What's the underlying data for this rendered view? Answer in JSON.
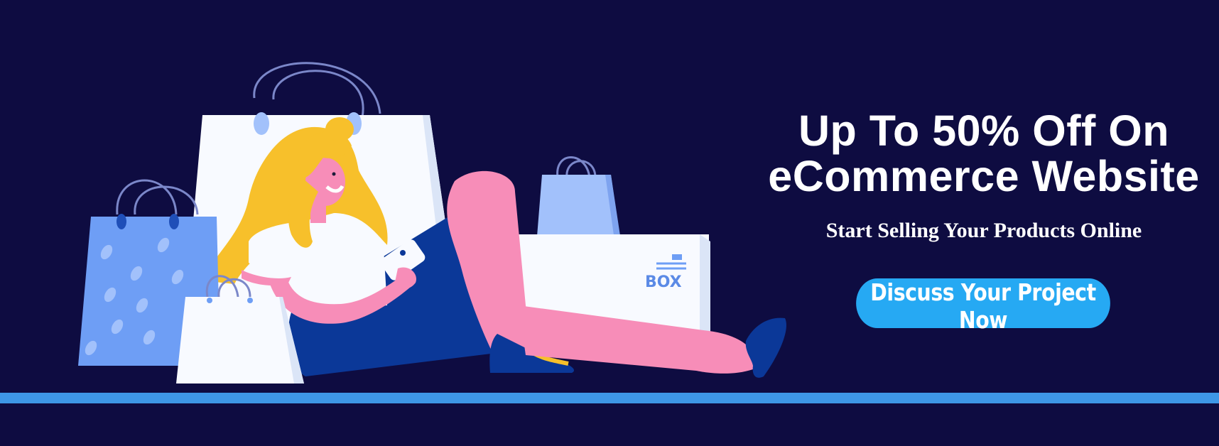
{
  "banner": {
    "headline_line1": "Up To 50% Off On",
    "headline_line2": "eCommerce Website",
    "subheadline": "Start Selling Your Products Online",
    "cta_label": "Discuss Your Project Now",
    "box_label": "BOX"
  },
  "colors": {
    "background": "#0e0c41",
    "cta": "#26a9f3",
    "floor_stripe": "#3e97e6",
    "hair": "#f7c02b",
    "skin": "#f78db8",
    "pants": "#0b3898",
    "bag_blue": "#6e9ef5",
    "bag_light_blue": "#a2c1fb",
    "bag_white": "#f8faff"
  },
  "icons": [
    "shopping-bag-icon",
    "box-icon",
    "smartphone-icon"
  ]
}
